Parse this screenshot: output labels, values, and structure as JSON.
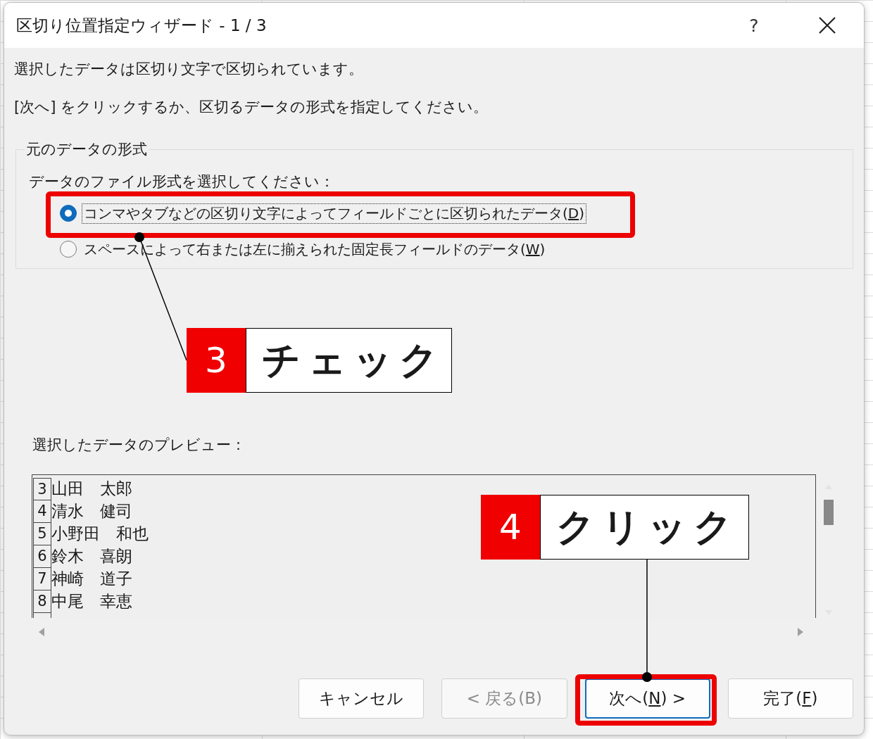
{
  "window": {
    "title": "区切り位置指定ウィザード - 1 / 3",
    "help_button": "?"
  },
  "messages": [
    "選択したデータは区切り文字で区切られています。",
    "[次へ] をクリックするか、区切るデータの形式を指定してください。"
  ],
  "group": {
    "title": "元のデータの形式",
    "prompt": "データのファイル形式を選択してください：",
    "options": [
      {
        "label": "コンマやタブなどの区切り文字によってフィールドごとに区切られたデータ(",
        "access_key": "D",
        "label_end": ")",
        "selected": true,
        "focused": true
      },
      {
        "label": "スペースによって右または左に揃えられた固定長フィールドのデータ(",
        "access_key": "W",
        "label_end": ")",
        "selected": false,
        "focused": false
      }
    ]
  },
  "preview": {
    "label": "選択したデータのプレビュー：",
    "rows": [
      {
        "line": "3",
        "text": "山田　太郎"
      },
      {
        "line": "4",
        "text": "清水　健司"
      },
      {
        "line": "5",
        "text": "小野田　和也"
      },
      {
        "line": "6",
        "text": "鈴木　喜朗"
      },
      {
        "line": "7",
        "text": "神崎　道子"
      },
      {
        "line": "8",
        "text": "中尾　幸恵"
      }
    ]
  },
  "buttons": [
    {
      "label": "キャンセル",
      "disabled": false,
      "default": false
    },
    {
      "label": "< 戻る(B)",
      "disabled": true,
      "default": false
    },
    {
      "label": "次へ(",
      "access_key": "N",
      "label_end": ") >",
      "disabled": false,
      "default": true
    },
    {
      "label": "完了(",
      "access_key": "F",
      "label_end": ")",
      "disabled": false,
      "default": false
    }
  ],
  "annotations": [
    {
      "number": "3",
      "text": "チェック"
    },
    {
      "number": "4",
      "text": "クリック"
    }
  ]
}
